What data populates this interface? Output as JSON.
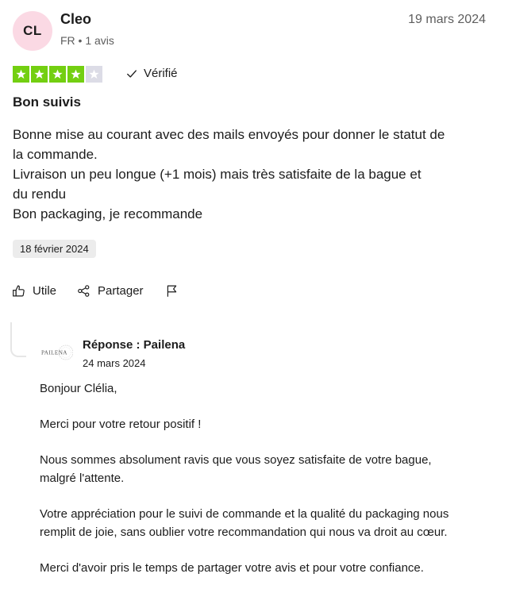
{
  "author": {
    "initials": "CL",
    "name": "Cleo",
    "meta": "FR • 1 avis"
  },
  "review": {
    "date": "19 mars 2024",
    "rating": 4,
    "rating_max": 5,
    "verified_label": "Vérifié",
    "title": "Bon suivis",
    "body_lines": [
      "Bonne mise au courant avec des mails envoyés pour donner le statut de",
      "la commande.",
      "Livraison un peu longue (+1 mois) mais très satisfaite de la bague et",
      "du rendu",
      "Bon packaging, je recommande"
    ],
    "experience_date": "18 février 2024"
  },
  "actions": {
    "useful_label": "Utile",
    "share_label": "Partager"
  },
  "reply": {
    "logo_text": "PAILENA",
    "title": "Réponse : Pailena",
    "date": "24 mars 2024",
    "paragraphs": [
      [
        "Bonjour Clélia,"
      ],
      [
        "Merci pour votre retour positif !"
      ],
      [
        "Nous sommes absolument ravis que vous soyez satisfaite de votre bague,",
        "malgré l'attente."
      ],
      [
        "Votre appréciation pour le suivi de commande et la qualité du packaging nous",
        "remplit de joie, sans oublier votre recommandation qui nous va droit au cœur."
      ],
      [
        "Merci d'avoir pris le temps de partager votre avis et pour votre confiance."
      ]
    ]
  },
  "colors": {
    "star_filled": "#73cf11",
    "star_empty": "#dcdce6",
    "avatar_bg": "#fbd9e4",
    "verified_check": "#1c1c1c"
  },
  "icons": {
    "star": "star-icon",
    "verified": "check-icon",
    "useful": "thumbs-up-icon",
    "share": "share-icon",
    "report": "flag-icon"
  }
}
